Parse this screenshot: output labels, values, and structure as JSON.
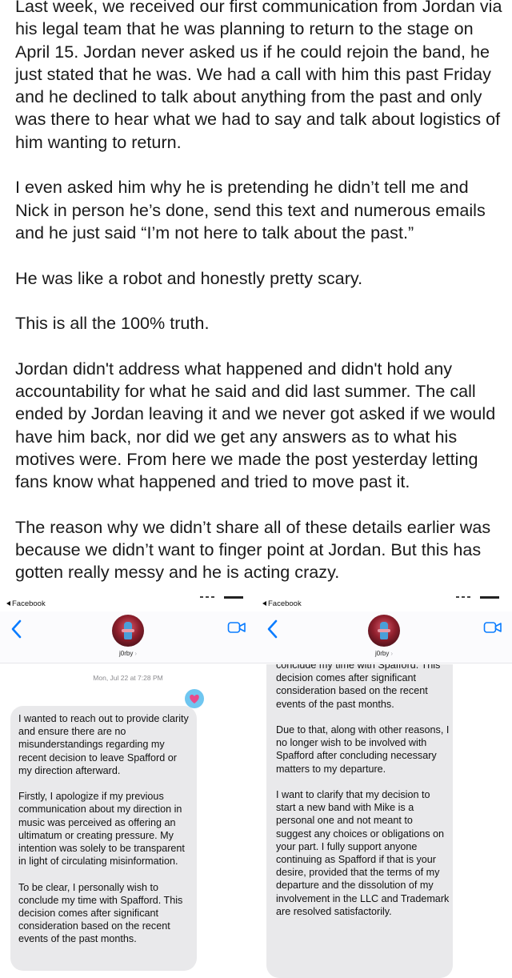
{
  "post": {
    "paragraphs": [
      "Last week, we received our first communication from Jordan via his legal team that he was planning to return to the stage on April 15.  Jordan never asked us if he could rejoin the band, he just stated that he was.  We had a call with him this past Friday and he declined to talk about anything from the past and only was there to hear what we had to say and talk about logistics of him wanting to return.",
      "I even asked him why he is pretending he didn’t tell me and Nick in person he’s done, send this text and numerous emails and he just said “I’m not here to talk about the past.”",
      "He was like a robot and honestly pretty scary.",
      "This is all the 100% truth.",
      "Jordan didn't address what happened and didn't hold any accountability for what he said and did last summer.  The call ended by Jordan leaving it and we never got asked if we would have him back, nor did we get any answers as to what his motives were.  From here we made the post yesterday letting fans know what happened and tried to move past it.",
      "The reason why we didn’t share all of these details earlier was because we didn’t want to finger point at Jordan.  But this has gotten really messy and he is acting crazy."
    ]
  },
  "left_phone": {
    "back_app": "Facebook",
    "contact": "j0rby",
    "timestamp": "Mon, Jul 22 at 7:28 PM",
    "bubble_text": "I wanted to reach out to provide clarity and ensure there are no misunderstandings regarding my recent decision to leave Spafford or my direction afterward.\n\nFirstly, I apologize if my previous communication about my direction in music was perceived as offering an ultimatum or creating pressure. My intention was solely to be transparent in light of circulating misinformation.\n\nTo be clear, I personally wish to conclude my time with Spafford. This decision comes after significant consideration based on the recent events of the past months.",
    "icons": [
      "chevron-left-icon",
      "video-camera-icon",
      "heart-bubble-icon"
    ]
  },
  "right_phone": {
    "back_app": "Facebook",
    "contact": "j0rby",
    "bubble_text": "conclude my time with Spafford. This decision comes after significant consideration based on the recent events of the past months.\n\nDue to that, along with other reasons, I no longer wish to be involved with Spafford after concluding necessary matters to my departure.\n\nI want to clarify that my decision to start a new band with Mike is a personal one and not meant to suggest any choices or obligations on your part. I fully support anyone continuing as Spafford if that is your desire, provided that the terms of my departure and the dissolution of my involvement in the LLC and Trademark are resolved satisfactorily.",
    "icons": [
      "chevron-left-icon",
      "video-camera-icon"
    ]
  },
  "colors": {
    "accent_blue": "#0a7cff",
    "bubble_gray": "#e9e9eb",
    "heart_pink": "#e94b8a",
    "heart_blue": "#6fc6f0"
  }
}
